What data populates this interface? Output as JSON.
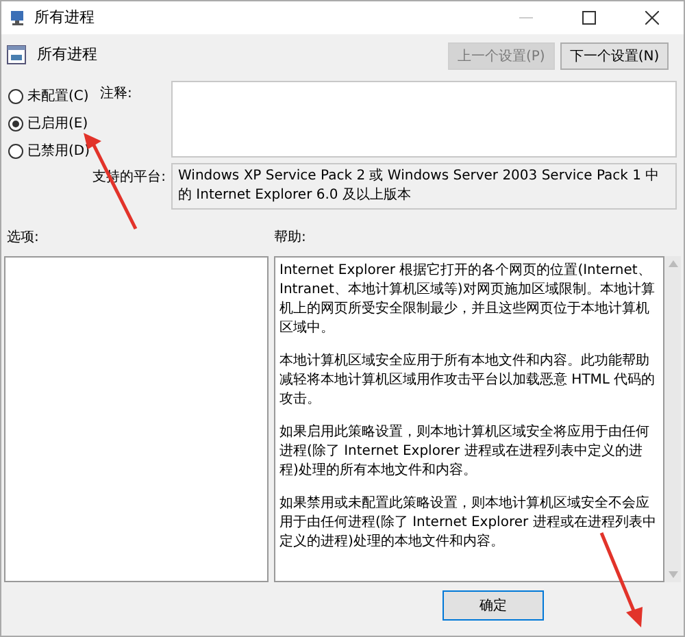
{
  "window": {
    "title": "所有进程"
  },
  "header": {
    "title": "所有进程"
  },
  "nav_buttons": [
    {
      "label": "上一个设置(P)",
      "disabled": true
    },
    {
      "label": "下一个设置(N)",
      "disabled": false
    }
  ],
  "options": [
    {
      "label": "未配置(C)",
      "selected": false
    },
    {
      "label": "已启用(E)",
      "selected": true
    },
    {
      "label": "已禁用(D)",
      "selected": false
    }
  ],
  "comment": {
    "label": "注释:"
  },
  "platform": {
    "label": "支持的平台:",
    "value": "Windows XP Service Pack 2 或 Windows Server 2003 Service Pack 1 中的 Internet Explorer 6.0 及以上版本"
  },
  "options_panel": {
    "label": "选项:"
  },
  "help_panel": {
    "label": "帮助:",
    "paragraphs": [
      "Internet Explorer 根据它打开的各个网页的位置(Internet、Intranet、本地计算机区域等)对网页施加区域限制。本地计算机上的网页所受安全限制最少，并且这些网页位于本地计算机区域中。",
      "本地计算机区域安全应用于所有本地文件和内容。此功能帮助减轻将本地计算机区域用作攻击平台以加载恶意 HTML 代码的攻击。",
      "如果启用此策略设置，则本地计算机区域安全将应用于由任何进程(除了 Internet Explorer 进程或在进程列表中定义的进程)处理的所有本地文件和内容。",
      "如果禁用或未配置此策略设置，则本地计算机区域安全不会应用于由任何进程(除了 Internet Explorer 进程或在进程列表中定义的进程)处理的本地文件和内容。"
    ]
  },
  "footer_buttons": [
    {
      "label": "确定"
    }
  ],
  "annotation_arrows": [
    {
      "kind": "arrow"
    },
    {
      "kind": "arrow"
    }
  ]
}
